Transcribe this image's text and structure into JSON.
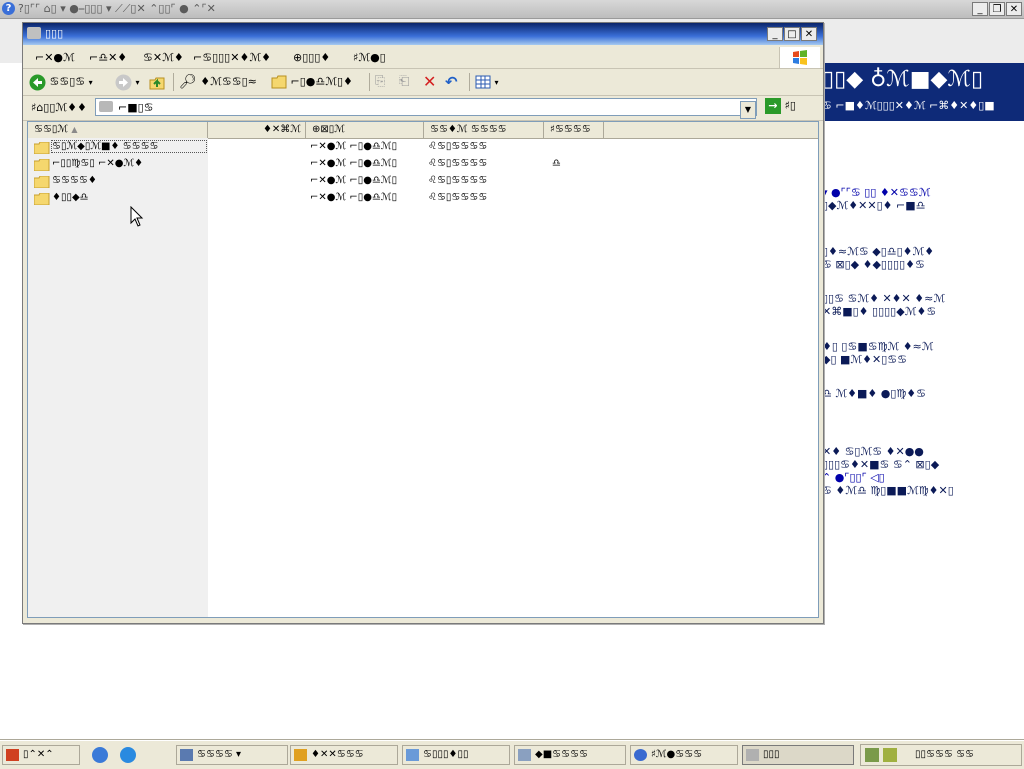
{
  "outer_window": {
    "title": "?▯⌜⌜ ⌂▯ ▾ ●⎯▯▯▯ ▾ ⟋⟋▯✕ ⌃▯▯⌜ ● ⌃⌜✕"
  },
  "background_page": {
    "header_big": "▯▯◆ ♁ℳ■◆ℳ▯",
    "header_small": "♋ ⌐■♦ℳ▯▯▯✕♦ℳ ⌐⌘♦✕♦▯■",
    "lines": [
      "▾ ●⌜⌜♋ ▯▯ ♦✕♋♋ℳ",
      "▯◆ℳ♦✕✕▯♦ ⌐■♎",
      "▯♦≈ℳ♋ ◆▯♎▯♦ℳ♦",
      "♋ ⊠▯◆ ♦◆▯▯▯▯♦♋",
      "▯▯♋ ♋ℳ♦ ✕♦✕ ♦≈ℳ",
      "✕⌘■▯♦ ▯▯▯▯◆ℳ♦♋",
      "♦▯ ▯♋■♋♍ℳ ♦≈ℳ",
      "◆▯ ■ℳ♦✕▯♋♋",
      "♎ ℳ♦■♦ ●▯♍♦♋",
      "✕♦ ♋▯ℳ♋ ♦✕●●",
      "▯▯▯♋♦✕■♋ ♋⌃ ⊠▯◆",
      "⌃ ●⌜▯▯⌜ ◁▯",
      "♋ ♦ℳ♎ ♍▯■■ℳ♍♦✕▯"
    ]
  },
  "explorer": {
    "title": "▯▯▯",
    "menu": [
      "⌐✕●ℳ",
      "⌐♎✕♦",
      "♋✕ℳ♦",
      "⌐♋▯▯▯✕♦ℳ♦",
      "⊕▯▯▯♦",
      "♯ℳ●▯"
    ],
    "toolbar": {
      "back_label": "♋♋▯♋",
      "search_label": "♦ℳ♋♋▯≈",
      "folders_label": "⌐▯●♎ℳ▯♦"
    },
    "address": {
      "label": "♯⌂▯▯ℳ♦♦",
      "value": "⌐■▯♋",
      "go_label": "♯▯"
    },
    "columns": [
      "♋♋▯ℳ",
      "♦✕⌘ℳ",
      "⊕⊠▯ℳ",
      "♋♋♦ℳ ♋♋♋♋",
      "♯♋♋♋♋"
    ],
    "rows": [
      {
        "name": "♋▯ℳ◆▯ℳ■♦ ♋♋♋♋",
        "size": "",
        "type": "⌐✕●ℳ ⌐▯●♎ℳ▯",
        "date": "♌♋▯♋♋♋♋",
        "attr": ""
      },
      {
        "name": "⌐▯▯♍♋▯ ⌐✕●ℳ♦",
        "size": "",
        "type": "⌐✕●ℳ ⌐▯●♎ℳ▯",
        "date": "♌♋▯♋♋♋♋",
        "attr": "♎"
      },
      {
        "name": "♋♋♋♋♦",
        "size": "",
        "type": "⌐✕●ℳ ⌐▯●♎ℳ▯",
        "date": "♌♋▯♋♋♋♋",
        "attr": ""
      },
      {
        "name": "♦▯▯◆♎",
        "size": "",
        "type": "⌐✕●ℳ ⌐▯●♎ℳ▯",
        "date": "♌♋▯♋♋♋♋",
        "attr": ""
      }
    ]
  },
  "taskbar": {
    "start_label": "▯⌃✕⌃",
    "tasks": [
      {
        "label": "♋♋♋♋ ▾",
        "active": false
      },
      {
        "label": "♦✕✕♋♋♋",
        "active": false
      },
      {
        "label": "♋▯▯▯♦▯▯",
        "active": false
      },
      {
        "label": "◆■♋♋♋♋",
        "active": false
      },
      {
        "label": "♯ℳ●♋♋♋",
        "active": false
      },
      {
        "label": "▯▯▯",
        "active": true
      }
    ],
    "tray_text": "▯▯♋♋♋ ♋♋"
  },
  "colors": {
    "titlebar_start": "#0a246a",
    "titlebar_end": "#a6caf0",
    "window_face": "#ece9d8",
    "bg_header": "#0e2a78"
  }
}
